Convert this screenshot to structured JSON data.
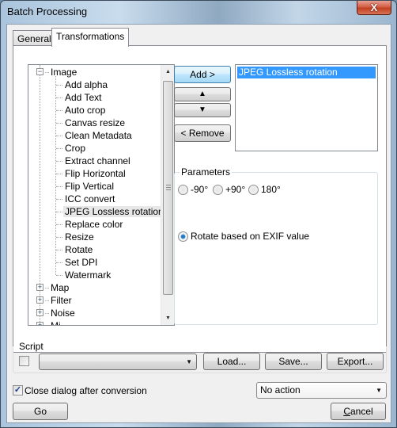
{
  "window": {
    "title": "Batch Processing",
    "close_glyph": "X"
  },
  "tabs": [
    {
      "label": "General",
      "active": false
    },
    {
      "label": "Transformations",
      "active": true
    }
  ],
  "tree": {
    "groups": [
      {
        "label": "Image",
        "expanded": true,
        "children": [
          "Add alpha",
          "Add Text",
          "Auto crop",
          "Canvas resize",
          "Clean Metadata",
          "Crop",
          "Extract channel",
          "Flip Horizontal",
          "Flip Vertical",
          "ICC convert",
          "JPEG Lossless rotation",
          "Replace color",
          "Resize",
          "Rotate",
          "Set DPI",
          "Watermark"
        ],
        "selected_child": "JPEG Lossless rotation"
      },
      {
        "label": "Map",
        "expanded": false
      },
      {
        "label": "Filter",
        "expanded": false
      },
      {
        "label": "Noise",
        "expanded": false
      },
      {
        "label": "Mi...",
        "expanded": false
      }
    ],
    "expander_collapsed": "+",
    "expander_expanded": "−"
  },
  "buttons": {
    "add": "Add >",
    "move_up": "▲",
    "move_down": "▼",
    "remove": "< Remove",
    "load": "Load...",
    "save": "Save...",
    "export": "Export...",
    "go": "Go",
    "cancel_prefix": "C",
    "cancel_rest": "ancel"
  },
  "transform_list": {
    "items": [
      "JPEG Lossless rotation"
    ],
    "selected": "JPEG Lossless rotation"
  },
  "parameters": {
    "title": "Parameters",
    "options": [
      {
        "label": "-90°",
        "checked": false
      },
      {
        "label": "+90°",
        "checked": false
      },
      {
        "label": "180°",
        "checked": false
      },
      {
        "label": "Rotate based on EXIF value",
        "checked": true
      }
    ]
  },
  "script": {
    "title": "Script",
    "enabled": false,
    "selected_value": ""
  },
  "footer": {
    "close_after_label": "Close dialog after conversion",
    "close_after_checked": true,
    "after_action_value": "No action"
  },
  "icons": {
    "scroll_up": "▲",
    "scroll_down": "▼",
    "dropdown": "▼",
    "check": "✓"
  }
}
